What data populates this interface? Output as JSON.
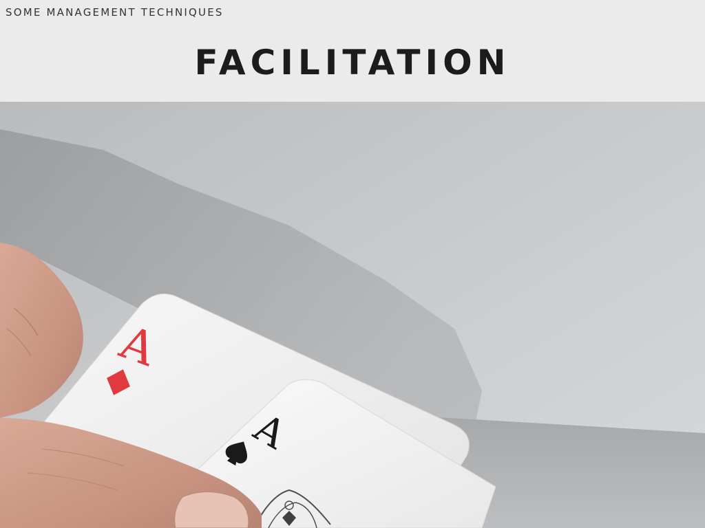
{
  "header": {
    "section_label": "SOME MANAGEMENT TECHNIQUES",
    "title": "FACILITATION"
  },
  "photo": {
    "cards": [
      {
        "rank": "A",
        "suit": "diamond",
        "color": "#e0393e"
      },
      {
        "rank": "A",
        "suit": "spade",
        "color": "#1a1a1a"
      }
    ]
  },
  "colors": {
    "header_bg": "#ebebeb",
    "title_text": "#1c1c1c",
    "red_suit": "#e0393e",
    "black_suit": "#1a1a1a"
  }
}
